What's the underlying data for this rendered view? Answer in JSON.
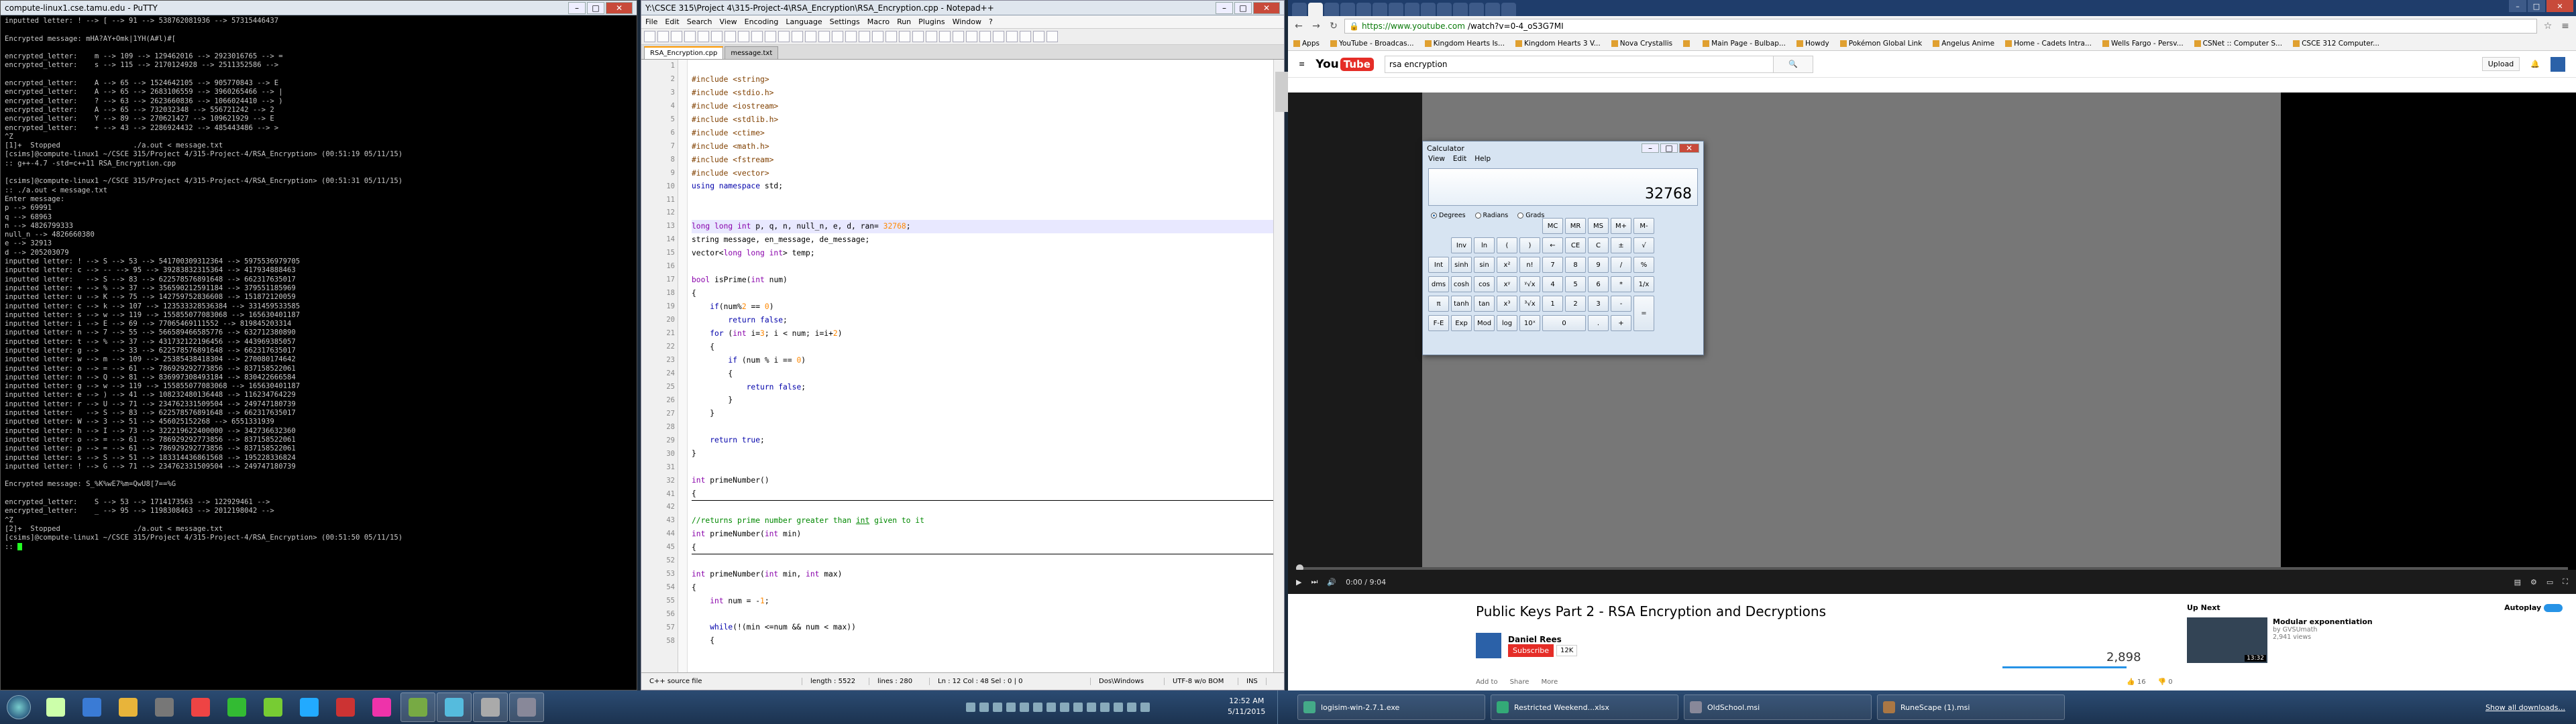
{
  "putty": {
    "title": "compute-linux1.cse.tamu.edu - PuTTY",
    "lines": [
      "inputted letter: ! --> [ --> 91 --> 538762081936 --> 57315446437",
      "",
      "Encrypted message: mHA?AY+Omk|1YH(A#l)#[",
      "",
      "encrypted_letter:    m --> 109 --> 129462016 --> 2923016765 --> =",
      "encrypted_letter:    s --> 115 --> 2170124928 --> 2511352586 -->",
      "",
      "encrypted_letter:    A --> 65 --> 1524642105 --> 905770843 --> E",
      "encrypted_letter:    A --> 65 --> 2683106559 --> 3960265466 --> |",
      "encrypted_letter:    ? --> 63 --> 2623660836 --> 1066024410 --> )",
      "encrypted_letter:    A --> 65 --> 732032348 --> 556721242 --> 2",
      "encrypted_letter:    Y --> 89 --> 270621427 --> 109621929 --> E",
      "encrypted_letter:    + --> 43 --> 2286924432 --> 485443486 --> >",
      "^Z",
      "[1]+  Stopped                 ./a.out < message.txt",
      "[csims]@compute-linux1 ~/CSCE 315/Project 4/315-Project-4/RSA_Encryption> (00:51:19 05/11/15)",
      ":: g++-4.7 -std=c++11 RSA_Encryption.cpp",
      "",
      "[csims]@compute-linux1 ~/CSCE 315/Project 4/315-Project-4/RSA_Encryption> (00:51:31 05/11/15)",
      ":: ./a.out < message.txt",
      "Enter message:",
      "p --> 69991",
      "q --> 68963",
      "n --> 4826799333",
      "null_n --> 4826660380",
      "e --> 32913",
      "d --> 205203079",
      "inputted letter: ! --> S --> 53 --> 541700309312364 --> 5975536979705",
      "inputted letter: c --> -- --> 95 --> 39283832315364 --> 417934888463",
      "inputted letter:   --> S --> 83 --> 622578576891648 --> 662317635017",
      "inputted letter: + --> % --> 37 --> 356590212591184 --> 379551185969",
      "inputted letter: u --> K --> 75 --> 142759752836608 --> 151872120059",
      "inputted letter: c --> k --> 107 --> 123533328536384 --> 331459533585",
      "inputted letter: s --> w --> 119 --> 155855077083068 --> 165630401187",
      "inputted letter: i --> E --> 69 --> 77065469111552 --> 819845203314",
      "inputted letter: n --> 7 --> 55 --> 566589466585776 --> 632712380890",
      "inputted letter: t --> % --> 37 --> 431732122196456 --> 443969385057",
      "inputted letter: g -->   --> 33 --> 622578576891648 --> 662317635017",
      "inputted letter: w --> m --> 109 --> 25385438418304 --> 270080174642",
      "inputted letter: o --> = --> 61 --> 786929292773856 --> 837158522061",
      "inputted letter: n --> Q --> 81 --> 836997308493184 --> 830422666584",
      "inputted letter: g --> w --> 119 --> 155855077083068 --> 165630401187",
      "inputted letter: e --> ) --> 41 --> 108232480136448 --> 116234764229",
      "inputted letter: r --> U --> 71 --> 234762331509504 --> 249747180739",
      "inputted letter:   --> S --> 83 --> 622578576891648 --> 662317635017",
      "inputted letter: W --> 3 --> 51 --> 456025152268 --> 6551331939",
      "inputted letter: h --> I --> 73 --> 322219622400000 --> 342736632360",
      "inputted letter: o --> = --> 61 --> 786929292773856 --> 837158522061",
      "inputted letter: p --> = --> 61 --> 786929292773856 --> 837158522061",
      "inputted letter: s --> S --> 51 --> 183314436861568 --> 195228336824",
      "inputted letter: ! --> G --> 71 --> 234762331509504 --> 249747180739",
      "",
      "Encrypted message: S_%K%wE7%m=QwU8[7==%G",
      "",
      "encrypted_letter:    S --> 53 --> 1714173563 --> 122929461 -->",
      "encrypted_letter:    _ --> 95 --> 1198308463 --> 2012198042 -->",
      "^Z",
      "[2]+  Stopped                 ./a.out < message.txt",
      "[csims]@compute-linux1 ~/CSCE 315/Project 4/315-Project-4/RSA_Encryption> (00:51:50 05/11/15)",
      ":: "
    ]
  },
  "npp": {
    "title": "Y:\\CSCE 315\\Project 4\\315-Project-4\\RSA_Encryption\\RSA_Encryption.cpp - Notepad++",
    "menu": [
      "File",
      "Edit",
      "Search",
      "View",
      "Encoding",
      "Language",
      "Settings",
      "Macro",
      "Run",
      "Plugins",
      "Window",
      "?"
    ],
    "tabs": [
      "RSA_Encryption.cpp",
      "message.txt"
    ],
    "line_numbers": [
      "1",
      "2",
      "3",
      "4",
      "5",
      "6",
      "7",
      "8",
      "9",
      "10",
      "11",
      "12",
      "13",
      "14",
      "15",
      "16",
      "17",
      "18",
      "19",
      "20",
      "21",
      "22",
      "23",
      "24",
      "25",
      "26",
      "27",
      "28",
      "29",
      "30",
      "31",
      "32",
      "41",
      "42",
      "43",
      "44",
      "45",
      "52",
      "53",
      "54",
      "55",
      "56",
      "57",
      "58"
    ],
    "status": {
      "type": "C++ source file",
      "length": "length : 5522",
      "lines": "lines : 280",
      "pos": "Ln : 12    Col : 48    Sel : 0 | 0",
      "eol": "Dos\\Windows",
      "enc": "UTF-8 w/o BOM",
      "ins": "INS"
    }
  },
  "chrome": {
    "url_host": "https://www.youtube.com",
    "url_path": "/watch?v=0-4_oS3G7MI",
    "bookmarks": [
      "Apps",
      "YouTube - Broadcas...",
      "Kingdom Hearts Is...",
      "Kingdom Hearts 3 V...",
      "Nova Crystallis",
      "",
      "Main Page - Bulbap...",
      "Howdy",
      "Pokémon Global Link",
      "Angelus Anime",
      "Home - Cadets Intra...",
      "Wells Fargo - Persv...",
      "CSNet :: Computer S...",
      "CSCE 312 Computer..."
    ],
    "search_value": "rsa encryption",
    "upload": "Upload",
    "time": "0:00 / 9:04",
    "video_title": "Public Keys Part 2 - RSA Encryption and Decryptions",
    "channel": "Daniel Rees",
    "subscribe": "Subscribe",
    "sub_count": "12K",
    "views": "2,898",
    "actions": [
      "Add to",
      "Share",
      "More"
    ],
    "likes": [
      "16",
      "0"
    ],
    "up_next": "Up Next",
    "autoplay": "Autoplay",
    "next_title": "Modular exponentiation",
    "next_channel": "by GVSUmath",
    "next_views": "2,941 views",
    "next_dur": "13:32"
  },
  "calc": {
    "title": "Calculator",
    "menu": [
      "View",
      "Edit",
      "Help"
    ],
    "display": "32768",
    "modes": [
      "Degrees",
      "Radians",
      "Grads"
    ],
    "mem_keys": [
      "MC",
      "MR",
      "MS",
      "M+",
      "M-"
    ],
    "rows": [
      [
        "",
        "Inv",
        "ln",
        "(",
        ")",
        "←",
        "CE",
        "C",
        "±",
        "√"
      ],
      [
        "Int",
        "sinh",
        "sin",
        "x²",
        "n!",
        "7",
        "8",
        "9",
        "/",
        "%"
      ],
      [
        "dms",
        "cosh",
        "cos",
        "xʸ",
        "ʸ√x",
        "4",
        "5",
        "6",
        "*",
        "1/x"
      ],
      [
        "π",
        "tanh",
        "tan",
        "x³",
        "³√x",
        "1",
        "2",
        "3",
        "-",
        ""
      ],
      [
        "F-E",
        "Exp",
        "Mod",
        "log",
        "10ˣ",
        "0",
        "",
        ".",
        "+",
        "="
      ]
    ]
  },
  "taskbar": {
    "time": "12:52 AM",
    "date": "5/11/2015",
    "windows2": [
      "logisim-win-2.7.1.exe",
      "Restricted Weekend...xlsx",
      "OldSchool.msi",
      "RuneScape (1).msi"
    ],
    "show_all": "Show all downloads..."
  },
  "colors": {
    "putty_bg": "#000000",
    "accent_red": "#e52d27",
    "keyword": "#0000aa"
  }
}
